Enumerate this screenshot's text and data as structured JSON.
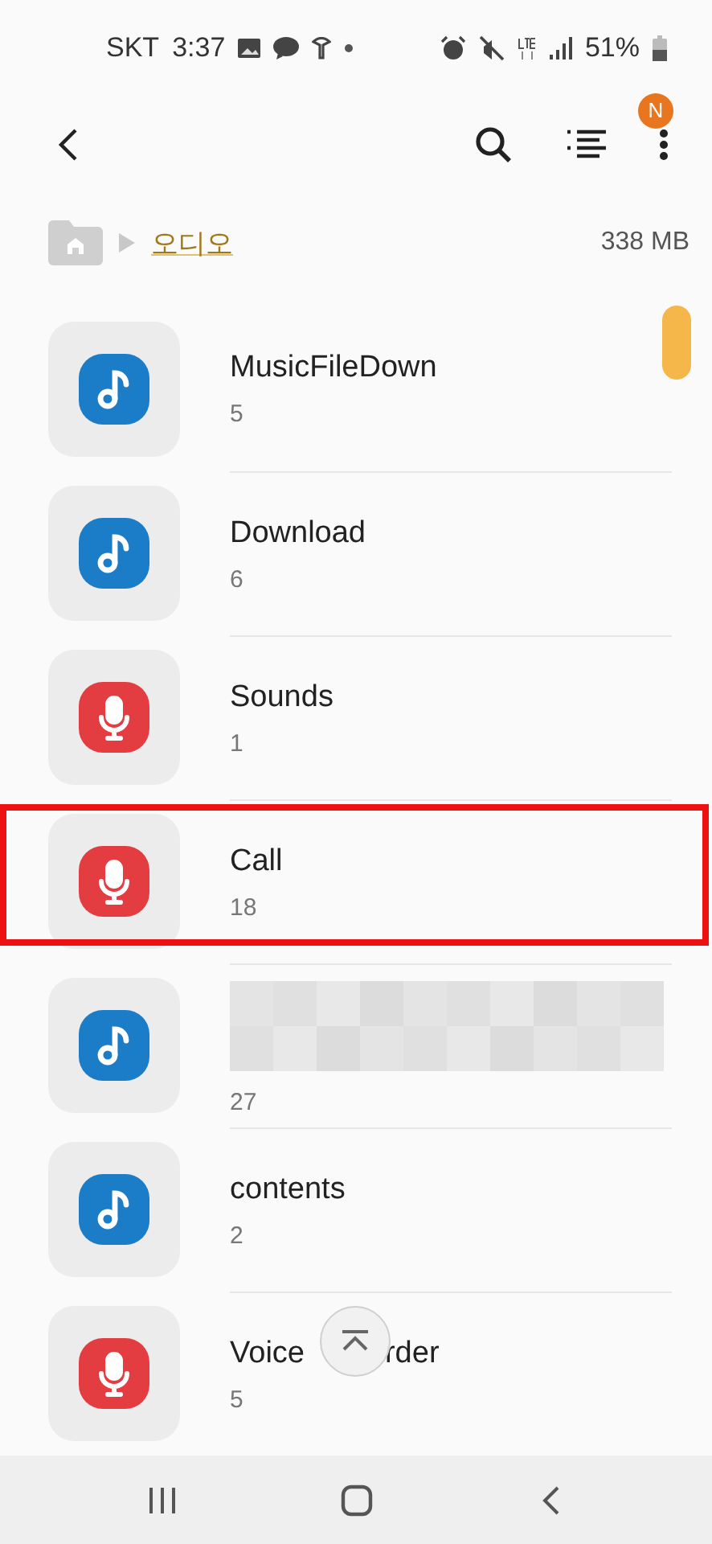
{
  "status_bar": {
    "carrier": "SKT",
    "time": "3:37",
    "battery": "51%"
  },
  "breadcrumb": {
    "folder": "오디오",
    "size": "338 MB"
  },
  "header": {
    "badge": "N"
  },
  "items": [
    {
      "kind": "music",
      "title": "MusicFileDown",
      "count": "5"
    },
    {
      "kind": "music",
      "title": "Download",
      "count": "6"
    },
    {
      "kind": "voice",
      "title": "Sounds",
      "count": "1"
    },
    {
      "kind": "voice",
      "title": "Call",
      "count": "18",
      "highlighted": true
    },
    {
      "kind": "music",
      "count": "27",
      "redacted": true
    },
    {
      "kind": "music",
      "title": "contents",
      "count": "2"
    },
    {
      "kind": "voice",
      "title": "Voice",
      "title_after_overlay": "rder",
      "count": "5"
    }
  ]
}
